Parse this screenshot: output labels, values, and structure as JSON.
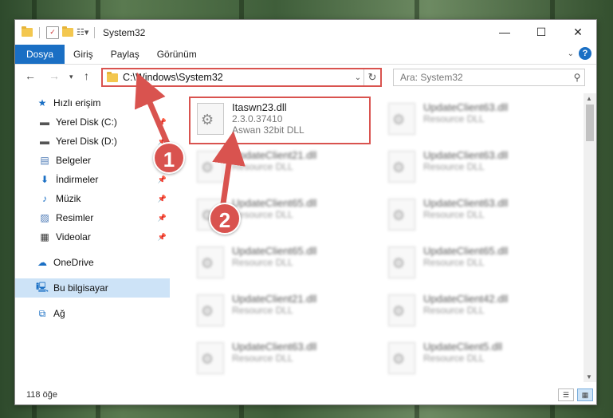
{
  "window": {
    "title": "System32",
    "controls": [
      "minimize-icon",
      "maximize-icon",
      "close-icon"
    ]
  },
  "ribbon": {
    "tabs": [
      {
        "label": "Dosya",
        "active": true
      },
      {
        "label": "Giriş"
      },
      {
        "label": "Paylaş"
      },
      {
        "label": "Görünüm"
      }
    ],
    "help": "?"
  },
  "address": {
    "path": "C:\\Windows\\System32",
    "search_placeholder": "Ara: System32"
  },
  "sidebar": {
    "quick_access": "Hızlı erişim",
    "items": [
      {
        "label": "Yerel Disk (C:)",
        "icon": "drive-icon",
        "pinned": true
      },
      {
        "label": "Yerel Disk (D:)",
        "icon": "drive-icon",
        "pinned": true
      },
      {
        "label": "Belgeler",
        "icon": "document-icon",
        "pinned": true
      },
      {
        "label": "İndirmeler",
        "icon": "download-icon",
        "pinned": true
      },
      {
        "label": "Müzik",
        "icon": "music-icon",
        "pinned": true
      },
      {
        "label": "Resimler",
        "icon": "pictures-icon",
        "pinned": true
      },
      {
        "label": "Videolar",
        "icon": "video-icon",
        "pinned": true
      }
    ],
    "onedrive": "OneDrive",
    "this_pc": "Bu bilgisayar",
    "network": "Ağ"
  },
  "files": {
    "highlighted": {
      "name": "Itaswn23.dll",
      "version": "2.3.0.37410",
      "type": "Aswan 32bit DLL"
    },
    "left_column": [
      {
        "name": "UpdateClient21.dll",
        "type": "Resource DLL"
      },
      {
        "name": "UpdateClient65.dll",
        "type": "Resource DLL"
      },
      {
        "name": "UpdateClient65.dll",
        "type": "Resource DLL"
      },
      {
        "name": "UpdateClient21.dll",
        "type": "Resource DLL"
      },
      {
        "name": "UpdateClient63.dll",
        "type": "Resource DLL"
      }
    ],
    "right_column": [
      {
        "name": "UpdateClient63.dll",
        "type": "Resource DLL"
      },
      {
        "name": "UpdateClient63.dll",
        "type": "Resource DLL"
      },
      {
        "name": "UpdateClient63.dll",
        "type": "Resource DLL"
      },
      {
        "name": "UpdateClient65.dll",
        "type": "Resource DLL"
      },
      {
        "name": "UpdateClient42.dll",
        "type": "Resource DLL"
      },
      {
        "name": "UpdateClient5.dll",
        "type": "Resource DLL"
      }
    ]
  },
  "status": {
    "count": "118 öğe"
  },
  "callouts": {
    "one": "1",
    "two": "2",
    "color": "#d9534f"
  },
  "colors": {
    "accent": "#1a6fc4",
    "selection": "#cde3f7"
  }
}
